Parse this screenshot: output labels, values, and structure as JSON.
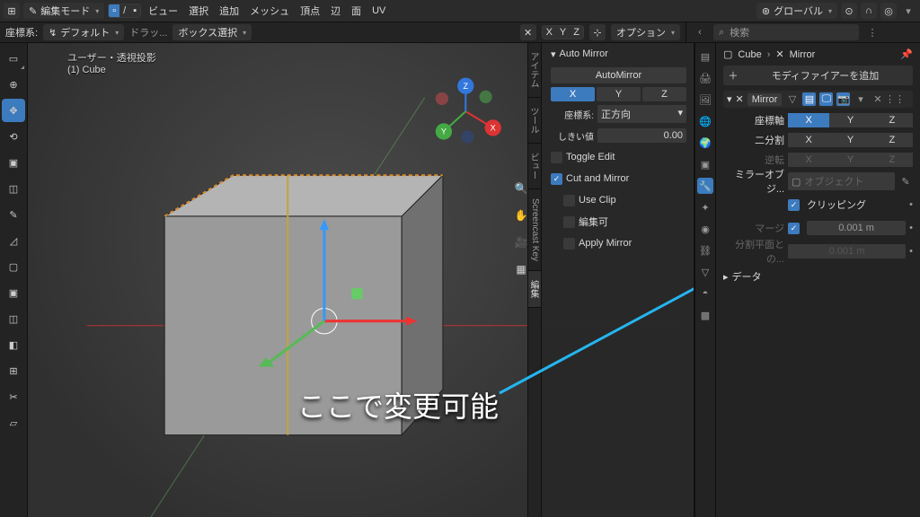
{
  "header": {
    "mode": "編集モード",
    "menu": [
      "ビュー",
      "選択",
      "追加",
      "メッシュ",
      "頂点",
      "辺",
      "面",
      "UV"
    ],
    "orientation": "グローバル",
    "options_label": "オプション"
  },
  "header2": {
    "coord_label": "座標系:",
    "coord_value": "デフォルト",
    "drag_label": "ドラッ...",
    "select_mode": "ボックス選択"
  },
  "axis_pills": [
    "X",
    "Y",
    "Z"
  ],
  "search_placeholder": "検索",
  "viewport_overlay": {
    "title": "ユーザー・透視投影",
    "subtitle": "(1) Cube"
  },
  "n_panel": {
    "section": "Auto Mirror",
    "button": "AutoMirror",
    "axes": [
      "X",
      "Y",
      "Z"
    ],
    "axis_active_index": 0,
    "coord_label": "座標系:",
    "coord_value": "正方向",
    "threshold_label": "しきい値",
    "threshold_value": "0.00",
    "toggle_edit": {
      "label": "Toggle Edit",
      "checked": false
    },
    "cut_mirror": {
      "label": "Cut and Mirror",
      "checked": true
    },
    "use_clip": {
      "label": "Use Clip",
      "checked": false
    },
    "editable": {
      "label": "編集可",
      "checked": false
    },
    "apply_mirror": {
      "label": "Apply Mirror",
      "checked": false
    }
  },
  "vtabs": [
    "アイテム",
    "ツール",
    "ビュー",
    "Screencast Key",
    "編集"
  ],
  "vtab_active_index": 4,
  "breadcrumb": {
    "object": "Cube",
    "modifier": "Mirror"
  },
  "add_modifier": "モディファイアーを追加",
  "modifier": {
    "name": "Mirror",
    "axis_label": "座標軸",
    "axis_vals": [
      "X",
      "Y",
      "Z"
    ],
    "axis_active": 0,
    "bisect_label": "二分割",
    "flip_label": "逆転",
    "mirror_obj_label": "ミラーオブジ...",
    "mirror_obj_placeholder": "オブジェクト",
    "clipping": {
      "label": "クリッピング",
      "checked": true
    },
    "merge": {
      "label": "マージ",
      "checked": true,
      "value": "0.001 m"
    },
    "bisect_dist": {
      "label": "分割平面との...",
      "value": "0.001 m"
    },
    "data_section": "データ"
  },
  "annotation": "ここで変更可能",
  "icons": {
    "blender": "◆",
    "edit": "✎",
    "globe": "◍",
    "magnet": "U",
    "snap": "◦",
    "cursor": "⊕",
    "move": "✥",
    "rot": "⟲",
    "scale": "□",
    "xform": "◫",
    "annot": "✎",
    "meas": "◿",
    "cube": "▢",
    "knife": "✂",
    "bevel": "◧",
    "loop": "⊞"
  }
}
